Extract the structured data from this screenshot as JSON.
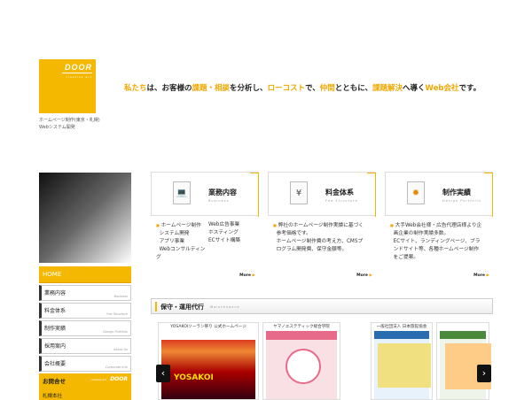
{
  "header": {
    "logo_text": "DOOR",
    "logo_sub": "creative act",
    "sub_line1": "ホームページ制作(東京・札幌)",
    "sub_line2": "Webシステム開発",
    "catch": [
      {
        "t": "私たち",
        "hl": true
      },
      {
        "t": "は、お客様の",
        "hl": false
      },
      {
        "t": "課題・相談",
        "hl": true
      },
      {
        "t": "を分析し、",
        "hl": false
      },
      {
        "t": "ローコスト",
        "hl": true
      },
      {
        "t": "で、",
        "hl": false
      },
      {
        "t": "仲間",
        "hl": true
      },
      {
        "t": "とともに、",
        "hl": false
      },
      {
        "t": "課題解決",
        "hl": true
      },
      {
        "t": "へ導く",
        "hl": false
      },
      {
        "t": "Web会社",
        "hl": true
      },
      {
        "t": "です。",
        "hl": false
      }
    ]
  },
  "side_nav": {
    "home": "HOME",
    "items": [
      {
        "jp": "業務内容",
        "en": "Business"
      },
      {
        "jp": "料金体系",
        "en": "Fee Structure"
      },
      {
        "jp": "制作実績",
        "en": "Design Portfolio"
      },
      {
        "jp": "採用案内",
        "en": "About Us"
      },
      {
        "jp": "会社概要",
        "en": "Corporate Info"
      }
    ],
    "contact_label": "お問合せ",
    "contact_brand": "DOOR",
    "contact_brand_sub": "creative act",
    "contact_phone": "札幌本社"
  },
  "panels": [
    {
      "title": "業務内容",
      "sub": "Business",
      "icon": "laptop-icon",
      "col1": [
        "ホームページ制作",
        "システム開発",
        "アプリ事業",
        "Webコンサルティング"
      ],
      "col2": [
        "Web広告事業",
        "ホスティング",
        "ECサイト構築"
      ],
      "more": "More"
    },
    {
      "title": "料金体系",
      "sub": "Fee Structure",
      "icon": "yen-icon",
      "text": [
        "弊社のホームページ制作実績に基づく",
        "参考価格です。",
        "ホームページ制作費の考え方、CMSプ",
        "ログラム開発費、保守金額等。"
      ],
      "more": "More"
    },
    {
      "title": "制作実績",
      "sub": "Design Portfolio",
      "icon": "gear-icon",
      "text": [
        "大手Web会社様・広告代理店様より企",
        "画企業の制作実績多数。",
        "ECサイト、ランディングページ、ブラ",
        "ンドサイト等、各種ホームページ制作",
        "をご提案。"
      ],
      "more": "More"
    }
  ],
  "maintenance": {
    "title": "保守・運用代行",
    "sub": "Maintenance"
  },
  "carousel": {
    "slides": [
      {
        "caption": "YOSAKOIソーラン祭り 公式ホームページ",
        "art": "YOSAKOI"
      },
      {
        "caption": "ヤマノエステティック総合学院"
      },
      {
        "caption": "一般社団法人 日本旅館協会"
      },
      {
        "caption": ""
      }
    ],
    "prev": "‹",
    "next": "›"
  }
}
